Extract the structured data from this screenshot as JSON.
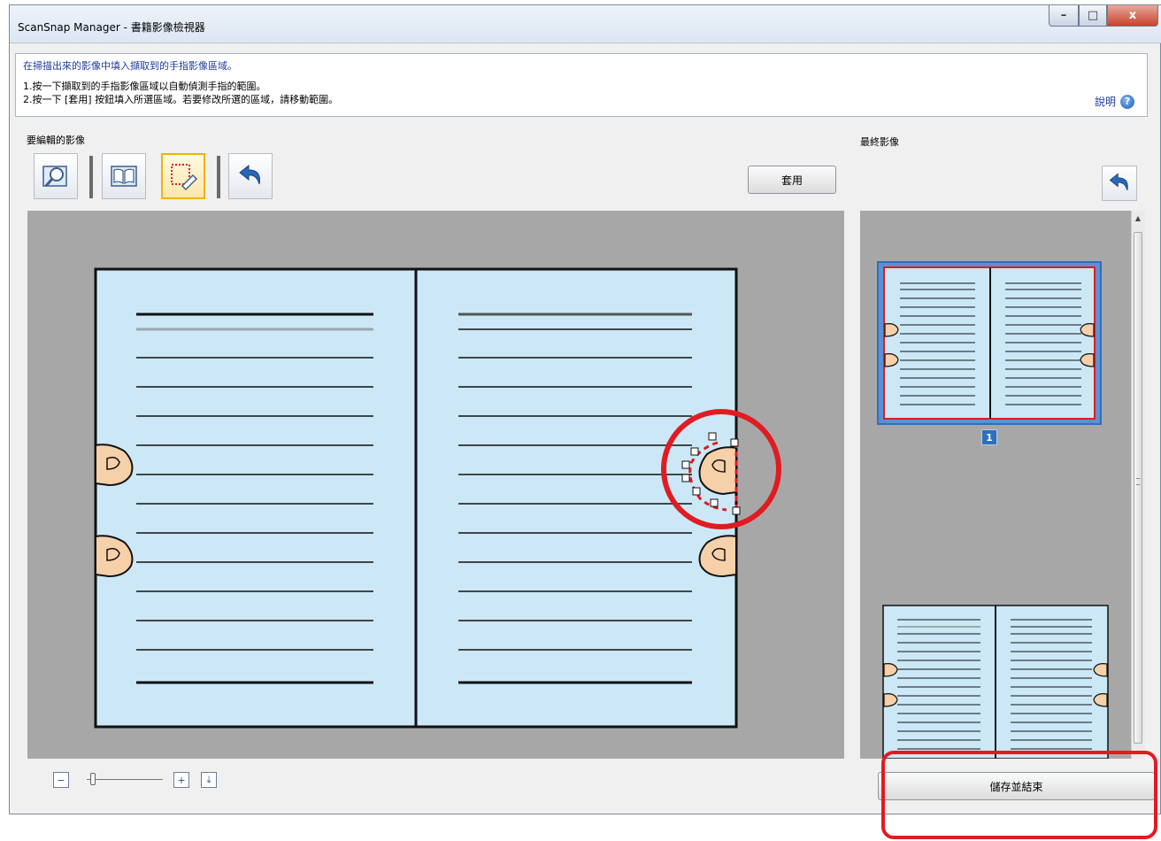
{
  "window": {
    "title": "ScanSnap Manager - 書籍影像檢視器",
    "controls": {
      "minimize": "–",
      "maximize": "□",
      "close": "x"
    }
  },
  "instructions": {
    "heading": "在掃描出來的影像中填入擷取到的手指影像區域。",
    "step1": "1.按一下擷取到的手指影像區域以自動偵測手指的範圍。",
    "step2": "2.按一下 [套用] 按鈕填入所選區域。若要修改所選的區域，請移動範圍。",
    "help_label": "說明",
    "help_icon": "?"
  },
  "editor": {
    "label": "要編輯的影像",
    "toolbar": {
      "tools": [
        {
          "name": "magnify-tool",
          "icon": "magnifier-icon",
          "active": false
        },
        {
          "name": "book-view-tool",
          "icon": "open-book-icon",
          "active": false
        },
        {
          "name": "finger-fill-tool",
          "icon": "dotted-selection-eraser-icon",
          "active": true
        },
        {
          "name": "undo-tool",
          "icon": "undo-arrow-icon",
          "active": false
        }
      ],
      "apply_label": "套用"
    }
  },
  "result": {
    "label": "最終影像",
    "page_number": "1",
    "save_label": "儲存並結束"
  },
  "zoom": {
    "zoom_out_icon": "zoom-out-icon",
    "zoom_in_icon": "zoom-in-icon",
    "fit_icon": "fit-page-icon",
    "level": 0.05
  },
  "colors": {
    "page": "#cce8f6",
    "finger": "#f6d0a8",
    "highlight_red": "#e11b22",
    "preview_bg": "#a7a7a7",
    "selected_border": "#2e6fbf"
  }
}
